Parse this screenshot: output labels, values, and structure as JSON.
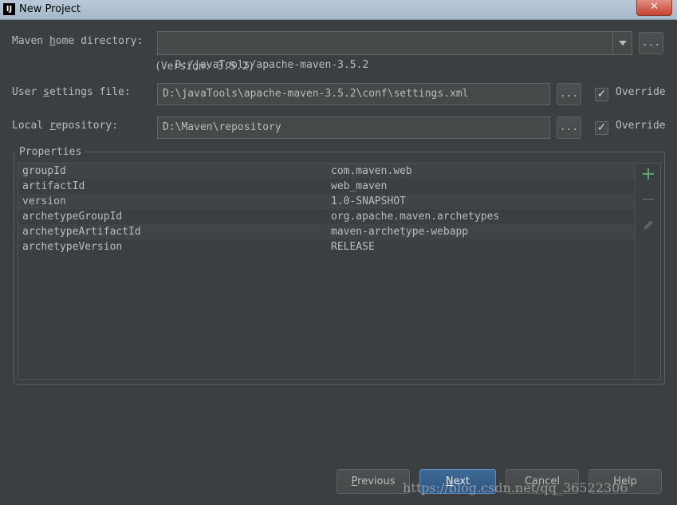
{
  "window": {
    "title": "New Project",
    "app_icon_text": "IJ",
    "close_label": "✕"
  },
  "form": {
    "maven_home": {
      "label_pre": "Maven ",
      "label_mn": "h",
      "label_post": "ome directory:",
      "value": "D:/javaTools/apache-maven-3.5.2",
      "version": "(Version: 3.5.2)"
    },
    "user_settings": {
      "label_pre": "User ",
      "label_mn": "s",
      "label_post": "ettings file:",
      "value": "D:\\javaTools\\apache-maven-3.5.2\\conf\\settings.xml",
      "override_label": "Override",
      "override_checked": true
    },
    "local_repo": {
      "label_pre": "Local ",
      "label_mn": "r",
      "label_post": "epository:",
      "value": "D:\\Maven\\repository",
      "override_label": "Override",
      "override_checked": true
    },
    "browse_label": "..."
  },
  "properties": {
    "title": "Properties",
    "rows": [
      {
        "key": "groupId",
        "value": "com.maven.web"
      },
      {
        "key": "artifactId",
        "value": "web_maven"
      },
      {
        "key": "version",
        "value": "1.0-SNAPSHOT"
      },
      {
        "key": "archetypeGroupId",
        "value": "org.apache.maven.archetypes"
      },
      {
        "key": "archetypeArtifactId",
        "value": "maven-archetype-webapp"
      },
      {
        "key": "archetypeVersion",
        "value": "RELEASE"
      }
    ],
    "tools": [
      "plus-icon",
      "minus-icon",
      "pencil-icon"
    ],
    "add_color": "#59a869"
  },
  "footer": {
    "previous_mn": "P",
    "previous_rest": "revious",
    "next_mn": "N",
    "next_rest": "ext",
    "cancel_label": "Cancel",
    "help_label": "Help"
  },
  "watermark": "https://blog.csdn.net/qq_36522306"
}
